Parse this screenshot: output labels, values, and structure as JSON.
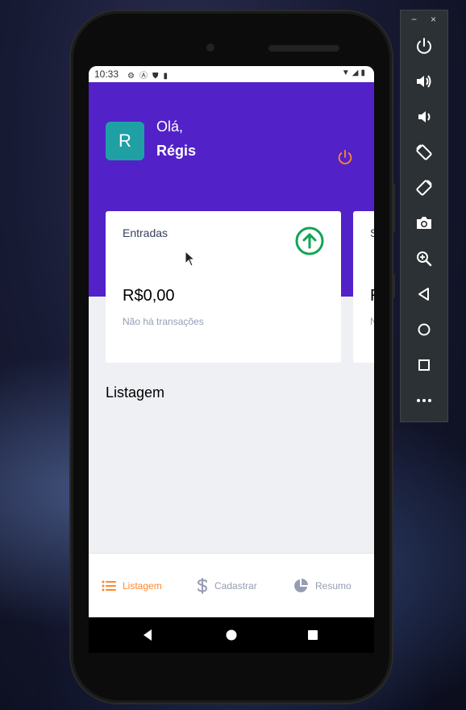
{
  "status_bar": {
    "time": "10:33",
    "left_icons": [
      "gear-icon",
      "a-icon",
      "shield-icon",
      "sd-card-icon"
    ],
    "right_icons": [
      "wifi-icon",
      "signal-icon",
      "battery-icon"
    ]
  },
  "header": {
    "avatar_letter": "R",
    "greeting": "Olá,",
    "user_name": "Régis",
    "power_color": "#ff872c"
  },
  "cards": [
    {
      "label": "Entradas",
      "amount": "R$0,00",
      "subtitle": "Não há transações",
      "icon": "arrow-up-circle-icon",
      "icon_color": "#12a454"
    },
    {
      "label": "S",
      "amount": "R",
      "subtitle": "N"
    }
  ],
  "list_title": "Listagem",
  "tabs": [
    {
      "label": "Listagem",
      "icon": "list-icon",
      "active": true
    },
    {
      "label": "Cadastrar",
      "icon": "dollar-icon",
      "active": false
    },
    {
      "label": "Resumo",
      "icon": "pie-chart-icon",
      "active": false
    }
  ],
  "colors": {
    "header_bg": "#5222c8",
    "accent": "#ff872c",
    "income": "#12a454",
    "page_bg": "#eef0f3"
  },
  "emulator": {
    "window_buttons": [
      "−",
      "×"
    ],
    "tools": [
      "power-icon",
      "volume-up-icon",
      "volume-down-icon",
      "rotate-left-icon",
      "rotate-right-icon",
      "camera-icon",
      "zoom-icon",
      "back-icon",
      "home-icon",
      "overview-icon",
      "more-icon"
    ]
  }
}
